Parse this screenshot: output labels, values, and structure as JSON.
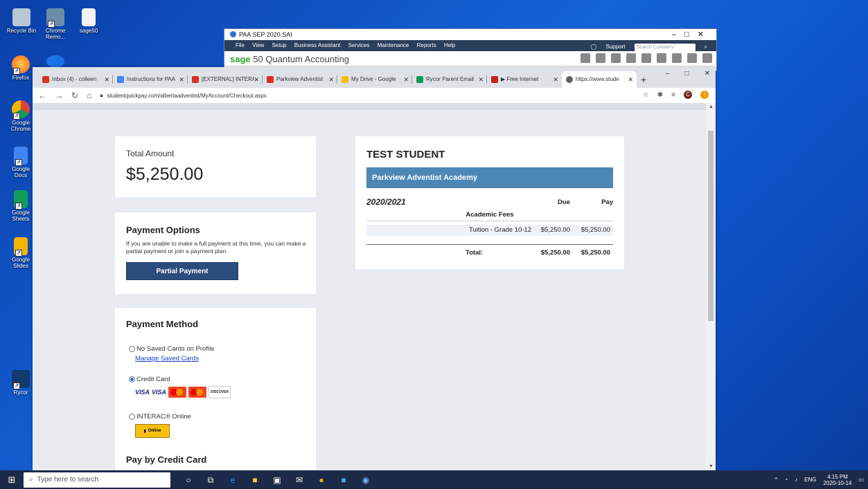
{
  "desktop": {
    "icons": [
      {
        "label": "Recycle Bin"
      },
      {
        "label": "Chrome Remo..."
      },
      {
        "label": "sage50"
      },
      {
        "label": "Firefox"
      },
      {
        "label": "Google Chrome"
      },
      {
        "label": "Google Docs"
      },
      {
        "label": "Google Sheets"
      },
      {
        "label": "Google Slides"
      },
      {
        "label": "Rycor"
      }
    ]
  },
  "sage": {
    "title": "PAA SEP 2020.SAI",
    "menu": [
      "File",
      "View",
      "Setup",
      "Business Assistant",
      "Services",
      "Maintenance",
      "Reports",
      "Help"
    ],
    "support": "Support",
    "search_placeholder": "Search Company",
    "brand_sage": "sage",
    "brand_rest": "50 Quantum Accounting"
  },
  "chrome": {
    "tabs": [
      {
        "title": "Inbox (4) - colleen",
        "color": "#d93025"
      },
      {
        "title": "Instructions for PAA",
        "color": "#4285f4"
      },
      {
        "title": "[EXTERNAL] INTERAC",
        "color": "#d93025"
      },
      {
        "title": "Parkview Adventist",
        "color": "#d93025"
      },
      {
        "title": "My Drive - Google",
        "color": "#fbbc04"
      },
      {
        "title": "Rycor Parent Email",
        "color": "#0f9d58"
      },
      {
        "title": "▶ Free Internet",
        "color": "#c5221f"
      },
      {
        "title": "https://www.stude",
        "color": "#5f6368"
      }
    ],
    "url": "studentquickpay.com/albertaadventist/MyAccount/Checkout.aspx"
  },
  "page": {
    "total_label": "Total Amount",
    "total_amount": "$5,250.00",
    "payment_options": {
      "title": "Payment Options",
      "text": "If you are unable to make a full payment at this time, you can make a partial payment or join a payment plan.",
      "button": "Partial Payment"
    },
    "payment_method": {
      "title": "Payment Method",
      "no_saved": "No Saved Cards on Profile",
      "manage": "Manage Saved Cards",
      "credit": "Credit Card",
      "interac": "INTERAC® Online",
      "interac_badge": "Online",
      "card_logos": [
        "VISA",
        "VISA"
      ],
      "discover": "DISCOVER",
      "pay_by": "Pay by Credit Card"
    },
    "summary": {
      "student": "TEST STUDENT",
      "school": "Parkview Adventist Academy",
      "year": "2020/2021",
      "due_header": "Due",
      "pay_header": "Pay",
      "category": "Academic Fees",
      "item_desc": "Tuition - Grade 10-12",
      "item_due": "$5,250.00",
      "item_pay": "$5,250.00",
      "total_label": "Total:",
      "total_due": "$5,250.00",
      "total_pay": "$5,250.00"
    }
  },
  "taskbar": {
    "search_placeholder": "Type here to search",
    "lang": "ENG",
    "time": "4:15 PM",
    "date": "2020-10-14"
  }
}
